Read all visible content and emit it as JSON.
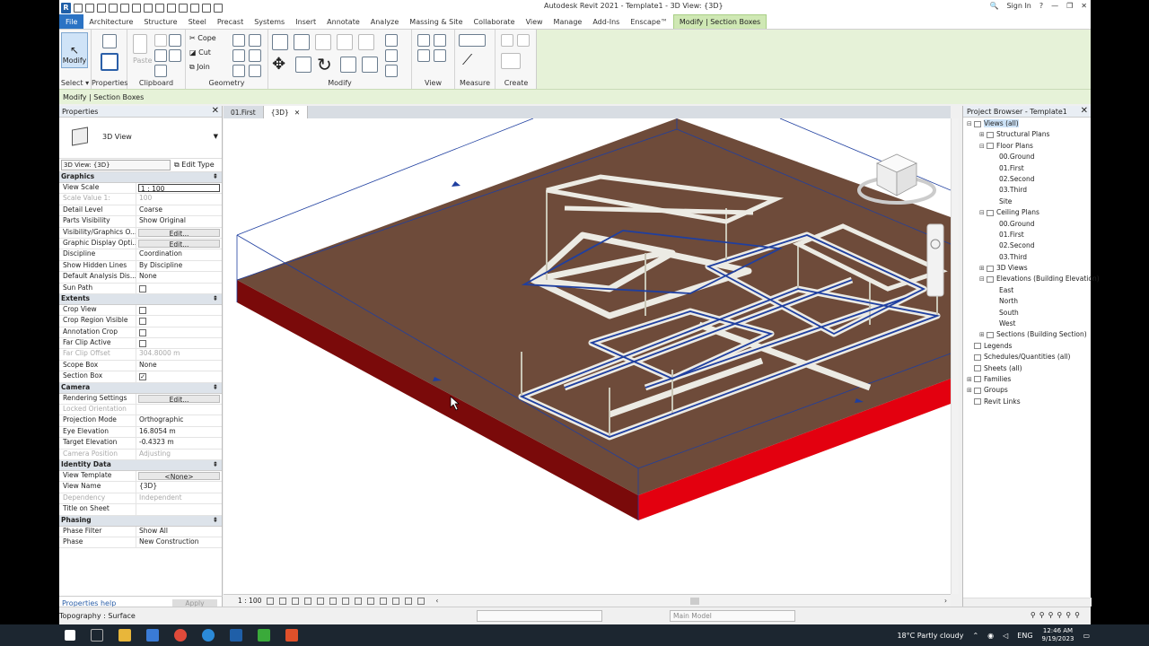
{
  "app": {
    "title": "Autodesk Revit 2021 - Template1 - 3D View: {3D}",
    "sign_in": "Sign In"
  },
  "tabs": [
    {
      "label": "File"
    },
    {
      "label": "Architecture"
    },
    {
      "label": "Structure"
    },
    {
      "label": "Steel"
    },
    {
      "label": "Precast"
    },
    {
      "label": "Systems"
    },
    {
      "label": "Insert"
    },
    {
      "label": "Annotate"
    },
    {
      "label": "Analyze"
    },
    {
      "label": "Massing & Site"
    },
    {
      "label": "Collaborate"
    },
    {
      "label": "View"
    },
    {
      "label": "Manage"
    },
    {
      "label": "Add-Ins"
    },
    {
      "label": "Enscape™"
    },
    {
      "label": "Modify | Section Boxes"
    }
  ],
  "ribbon": {
    "modify_label": "Modify",
    "select_label": "Select ▾",
    "panels": {
      "properties": "Properties",
      "clipboard": "Clipboard",
      "geometry": "Geometry",
      "modify": "Modify",
      "view": "View",
      "measure": "Measure",
      "create": "Create"
    },
    "paste": "Paste",
    "cope": "Cope",
    "cut": "Cut",
    "join": "Join"
  },
  "options_bar": "Modify | Section Boxes",
  "properties": {
    "title": "Properties",
    "type_name": "3D View",
    "view_type_selector": "3D View: {3D}",
    "edit_type": "Edit Type",
    "groups": [
      {
        "name": "Graphics",
        "rows": [
          {
            "k": "View Scale",
            "v": "1 : 100",
            "kind": "input"
          },
          {
            "k": "Scale Value    1:",
            "v": "100",
            "kind": "dim"
          },
          {
            "k": "Detail Level",
            "v": "Coarse"
          },
          {
            "k": "Parts Visibility",
            "v": "Show Original"
          },
          {
            "k": "Visibility/Graphics O...",
            "v": "Edit...",
            "kind": "btn"
          },
          {
            "k": "Graphic Display Opti...",
            "v": "Edit...",
            "kind": "btn"
          },
          {
            "k": "Discipline",
            "v": "Coordination"
          },
          {
            "k": "Show Hidden Lines",
            "v": "By Discipline"
          },
          {
            "k": "Default Analysis Dis...",
            "v": "None"
          },
          {
            "k": "Sun Path",
            "v": "",
            "kind": "chk"
          }
        ]
      },
      {
        "name": "Extents",
        "rows": [
          {
            "k": "Crop View",
            "v": "",
            "kind": "chk"
          },
          {
            "k": "Crop Region Visible",
            "v": "",
            "kind": "chk"
          },
          {
            "k": "Annotation Crop",
            "v": "",
            "kind": "chk"
          },
          {
            "k": "Far Clip Active",
            "v": "",
            "kind": "chk"
          },
          {
            "k": "Far Clip Offset",
            "v": "304.8000 m",
            "kind": "dim"
          },
          {
            "k": "Scope Box",
            "v": "None"
          },
          {
            "k": "Section Box",
            "v": "✓",
            "kind": "chk"
          }
        ]
      },
      {
        "name": "Camera",
        "rows": [
          {
            "k": "Rendering Settings",
            "v": "Edit...",
            "kind": "btn"
          },
          {
            "k": "Locked Orientation",
            "v": "",
            "kind": "dim"
          },
          {
            "k": "Projection Mode",
            "v": "Orthographic"
          },
          {
            "k": "Eye Elevation",
            "v": "16.8054 m"
          },
          {
            "k": "Target Elevation",
            "v": "-0.4323 m"
          },
          {
            "k": "Camera Position",
            "v": "Adjusting",
            "kind": "dim"
          }
        ]
      },
      {
        "name": "Identity Data",
        "rows": [
          {
            "k": "View Template",
            "v": "<None>",
            "kind": "btn"
          },
          {
            "k": "View Name",
            "v": "{3D}"
          },
          {
            "k": "Dependency",
            "v": "Independent",
            "kind": "dim"
          },
          {
            "k": "Title on Sheet",
            "v": ""
          }
        ]
      },
      {
        "name": "Phasing",
        "rows": [
          {
            "k": "Phase Filter",
            "v": "Show All"
          },
          {
            "k": "Phase",
            "v": "New Construction"
          }
        ]
      }
    ],
    "help_link": "Properties help",
    "apply": "Apply"
  },
  "doc_tabs": [
    {
      "label": "01.First",
      "active": false
    },
    {
      "label": "{3D}",
      "active": true
    }
  ],
  "view_control_bar": {
    "scale": "1 : 100"
  },
  "project_browser": {
    "title": "Project Browser - Template1",
    "items": [
      {
        "label": "Views (all)",
        "level": 0,
        "toggle": "⊟",
        "selected": true
      },
      {
        "label": "Structural Plans",
        "level": 1,
        "toggle": "⊞"
      },
      {
        "label": "Floor Plans",
        "level": 1,
        "toggle": "⊟"
      },
      {
        "label": "00.Ground",
        "level": 2,
        "toggle": ""
      },
      {
        "label": "01.First",
        "level": 2,
        "toggle": ""
      },
      {
        "label": "02.Second",
        "level": 2,
        "toggle": ""
      },
      {
        "label": "03.Third",
        "level": 2,
        "toggle": ""
      },
      {
        "label": "Site",
        "level": 2,
        "toggle": ""
      },
      {
        "label": "Ceiling Plans",
        "level": 1,
        "toggle": "⊟"
      },
      {
        "label": "00.Ground",
        "level": 2,
        "toggle": ""
      },
      {
        "label": "01.First",
        "level": 2,
        "toggle": ""
      },
      {
        "label": "02.Second",
        "level": 2,
        "toggle": ""
      },
      {
        "label": "03.Third",
        "level": 2,
        "toggle": ""
      },
      {
        "label": "3D Views",
        "level": 1,
        "toggle": "⊞"
      },
      {
        "label": "Elevations (Building Elevation)",
        "level": 1,
        "toggle": "⊟"
      },
      {
        "label": "East",
        "level": 2,
        "toggle": ""
      },
      {
        "label": "North",
        "level": 2,
        "toggle": ""
      },
      {
        "label": "South",
        "level": 2,
        "toggle": ""
      },
      {
        "label": "West",
        "level": 2,
        "toggle": ""
      },
      {
        "label": "Sections (Building Section)",
        "level": 1,
        "toggle": "⊞"
      },
      {
        "label": "Legends",
        "level": 0,
        "toggle": ""
      },
      {
        "label": "Schedules/Quantities (all)",
        "level": 0,
        "toggle": ""
      },
      {
        "label": "Sheets (all)",
        "level": 0,
        "toggle": ""
      },
      {
        "label": "Families",
        "level": 0,
        "toggle": "⊞"
      },
      {
        "label": "Groups",
        "level": 0,
        "toggle": "⊞"
      },
      {
        "label": "Revit Links",
        "level": 0,
        "toggle": ""
      }
    ]
  },
  "status_bar": {
    "left": "Topography : Surface",
    "workset": "Main Model"
  },
  "taskbar": {
    "weather": "18°C  Partly cloudy",
    "lang": "ENG",
    "time": "12:46 AM",
    "date": "9/19/2023"
  },
  "colors": {
    "topo_top": "#6e4b3a",
    "topo_side_front": "#e3000f",
    "topo_side_left": "#7a0a0a",
    "section_box": "#1f3fa0",
    "frame": "#ecebe4"
  }
}
